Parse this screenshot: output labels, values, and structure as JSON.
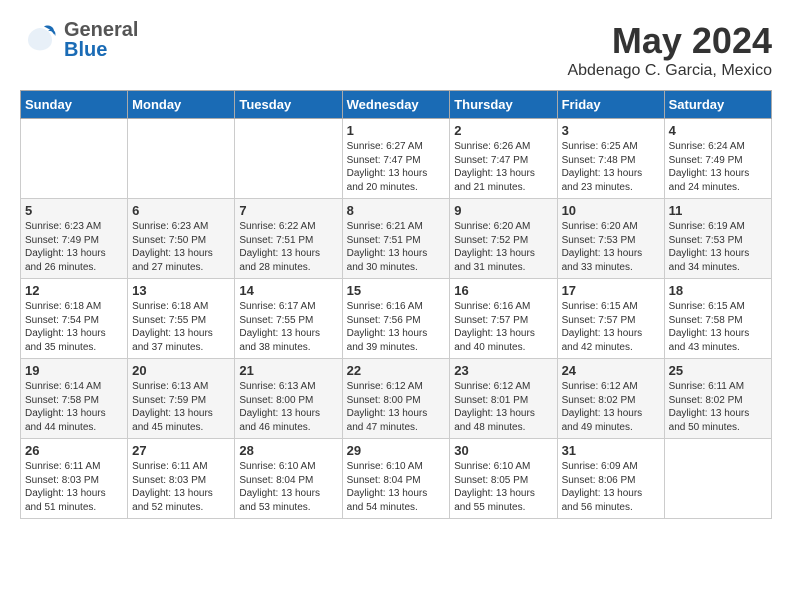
{
  "header": {
    "logo": {
      "general": "General",
      "blue": "Blue"
    },
    "title": "May 2024",
    "location": "Abdenago C. Garcia, Mexico"
  },
  "days_of_week": [
    "Sunday",
    "Monday",
    "Tuesday",
    "Wednesday",
    "Thursday",
    "Friday",
    "Saturday"
  ],
  "weeks": [
    {
      "days": [
        {
          "number": "",
          "info": ""
        },
        {
          "number": "",
          "info": ""
        },
        {
          "number": "",
          "info": ""
        },
        {
          "number": "1",
          "info": "Sunrise: 6:27 AM\nSunset: 7:47 PM\nDaylight: 13 hours\nand 20 minutes."
        },
        {
          "number": "2",
          "info": "Sunrise: 6:26 AM\nSunset: 7:47 PM\nDaylight: 13 hours\nand 21 minutes."
        },
        {
          "number": "3",
          "info": "Sunrise: 6:25 AM\nSunset: 7:48 PM\nDaylight: 13 hours\nand 23 minutes."
        },
        {
          "number": "4",
          "info": "Sunrise: 6:24 AM\nSunset: 7:49 PM\nDaylight: 13 hours\nand 24 minutes."
        }
      ]
    },
    {
      "days": [
        {
          "number": "5",
          "info": "Sunrise: 6:23 AM\nSunset: 7:49 PM\nDaylight: 13 hours\nand 26 minutes."
        },
        {
          "number": "6",
          "info": "Sunrise: 6:23 AM\nSunset: 7:50 PM\nDaylight: 13 hours\nand 27 minutes."
        },
        {
          "number": "7",
          "info": "Sunrise: 6:22 AM\nSunset: 7:51 PM\nDaylight: 13 hours\nand 28 minutes."
        },
        {
          "number": "8",
          "info": "Sunrise: 6:21 AM\nSunset: 7:51 PM\nDaylight: 13 hours\nand 30 minutes."
        },
        {
          "number": "9",
          "info": "Sunrise: 6:20 AM\nSunset: 7:52 PM\nDaylight: 13 hours\nand 31 minutes."
        },
        {
          "number": "10",
          "info": "Sunrise: 6:20 AM\nSunset: 7:53 PM\nDaylight: 13 hours\nand 33 minutes."
        },
        {
          "number": "11",
          "info": "Sunrise: 6:19 AM\nSunset: 7:53 PM\nDaylight: 13 hours\nand 34 minutes."
        }
      ]
    },
    {
      "days": [
        {
          "number": "12",
          "info": "Sunrise: 6:18 AM\nSunset: 7:54 PM\nDaylight: 13 hours\nand 35 minutes."
        },
        {
          "number": "13",
          "info": "Sunrise: 6:18 AM\nSunset: 7:55 PM\nDaylight: 13 hours\nand 37 minutes."
        },
        {
          "number": "14",
          "info": "Sunrise: 6:17 AM\nSunset: 7:55 PM\nDaylight: 13 hours\nand 38 minutes."
        },
        {
          "number": "15",
          "info": "Sunrise: 6:16 AM\nSunset: 7:56 PM\nDaylight: 13 hours\nand 39 minutes."
        },
        {
          "number": "16",
          "info": "Sunrise: 6:16 AM\nSunset: 7:57 PM\nDaylight: 13 hours\nand 40 minutes."
        },
        {
          "number": "17",
          "info": "Sunrise: 6:15 AM\nSunset: 7:57 PM\nDaylight: 13 hours\nand 42 minutes."
        },
        {
          "number": "18",
          "info": "Sunrise: 6:15 AM\nSunset: 7:58 PM\nDaylight: 13 hours\nand 43 minutes."
        }
      ]
    },
    {
      "days": [
        {
          "number": "19",
          "info": "Sunrise: 6:14 AM\nSunset: 7:58 PM\nDaylight: 13 hours\nand 44 minutes."
        },
        {
          "number": "20",
          "info": "Sunrise: 6:13 AM\nSunset: 7:59 PM\nDaylight: 13 hours\nand 45 minutes."
        },
        {
          "number": "21",
          "info": "Sunrise: 6:13 AM\nSunset: 8:00 PM\nDaylight: 13 hours\nand 46 minutes."
        },
        {
          "number": "22",
          "info": "Sunrise: 6:12 AM\nSunset: 8:00 PM\nDaylight: 13 hours\nand 47 minutes."
        },
        {
          "number": "23",
          "info": "Sunrise: 6:12 AM\nSunset: 8:01 PM\nDaylight: 13 hours\nand 48 minutes."
        },
        {
          "number": "24",
          "info": "Sunrise: 6:12 AM\nSunset: 8:02 PM\nDaylight: 13 hours\nand 49 minutes."
        },
        {
          "number": "25",
          "info": "Sunrise: 6:11 AM\nSunset: 8:02 PM\nDaylight: 13 hours\nand 50 minutes."
        }
      ]
    },
    {
      "days": [
        {
          "number": "26",
          "info": "Sunrise: 6:11 AM\nSunset: 8:03 PM\nDaylight: 13 hours\nand 51 minutes."
        },
        {
          "number": "27",
          "info": "Sunrise: 6:11 AM\nSunset: 8:03 PM\nDaylight: 13 hours\nand 52 minutes."
        },
        {
          "number": "28",
          "info": "Sunrise: 6:10 AM\nSunset: 8:04 PM\nDaylight: 13 hours\nand 53 minutes."
        },
        {
          "number": "29",
          "info": "Sunrise: 6:10 AM\nSunset: 8:04 PM\nDaylight: 13 hours\nand 54 minutes."
        },
        {
          "number": "30",
          "info": "Sunrise: 6:10 AM\nSunset: 8:05 PM\nDaylight: 13 hours\nand 55 minutes."
        },
        {
          "number": "31",
          "info": "Sunrise: 6:09 AM\nSunset: 8:06 PM\nDaylight: 13 hours\nand 56 minutes."
        },
        {
          "number": "",
          "info": ""
        }
      ]
    }
  ]
}
